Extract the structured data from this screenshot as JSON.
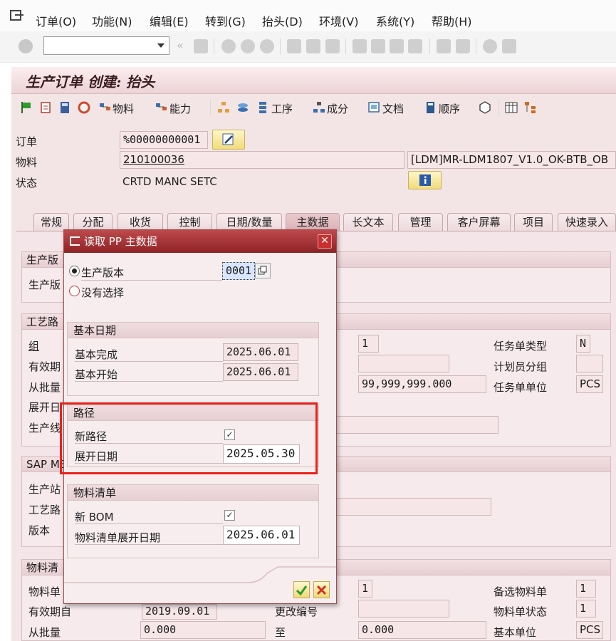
{
  "menu": [
    "订单(O)",
    "功能(N)",
    "编辑(E)",
    "转到(G)",
    "抬头(D)",
    "环境(V)",
    "系统(Y)",
    "帮助(H)"
  ],
  "page_title": "生产订单 创建: 抬头",
  "app_toolbar": {
    "material_label": "物料",
    "capacity_label": "能力",
    "operation_label": "工序",
    "component_label": "成分",
    "document_label": "文档",
    "sequence_label": "顺序"
  },
  "header": {
    "order_label": "订单",
    "order_value": "%00000000001",
    "material_label": "物料",
    "material_value": "210100036",
    "material_desc": "[LDM]MR-LDM1807_V1.0_OK-BTB_OB",
    "status_label": "状态",
    "status_value": "CRTD MANC SETC"
  },
  "tabs": [
    "常规",
    "分配",
    "收货",
    "控制",
    "日期/数量",
    "主数据",
    "长文本",
    "管理",
    "客户屏幕",
    "项目",
    "快速录入"
  ],
  "active_tab": "主数据",
  "background": {
    "group1_title": "生产版",
    "group1_row_label": "生产版",
    "group2_title": "工艺路",
    "group2_rows": [
      "组",
      "有效期",
      "从批量",
      "展开日",
      "生产线"
    ],
    "group2_right": {
      "counter_value": "1",
      "to_lot_value": "99,999,999.000",
      "task_type_label": "任务单类型",
      "task_type_value": "N",
      "planner_group_label": "计划员分组",
      "planner_group_value": "",
      "task_unit_label": "任务单单位",
      "task_unit_value": "PCS"
    },
    "group3_title": "SAP ME",
    "group3_rows": [
      "生产站",
      "工艺路",
      "版本"
    ],
    "group4_title": "物料清",
    "group4_rows": [
      "物料单",
      "有效期自",
      "从批量"
    ],
    "group4_right": {
      "bom_counter_value": "1",
      "alt_bom_label": "备选物料单",
      "alt_bom_value": "1",
      "valid_from_value": "2019.09.01",
      "change_no_label": "更改编号",
      "change_no_value": "",
      "bom_status_label": "物料单状态",
      "bom_status_value": "1",
      "from_lot_value": "0.000",
      "to_label": "至",
      "to_value": "0.000",
      "base_unit_label": "基本单位",
      "base_unit_value": "PCS"
    }
  },
  "dialog": {
    "title": "读取 PP 主数据",
    "radio_version_label": "生产版本",
    "radio_version_value": "0001",
    "radio_none_label": "没有选择",
    "basic_dates": {
      "title": "基本日期",
      "finish_label": "基本完成",
      "finish_value": "2025.06.01",
      "start_label": "基本开始",
      "start_value": "2025.06.01"
    },
    "routing": {
      "title": "路径",
      "new_routing_label": "新路径",
      "new_routing_checked": true,
      "explosion_date_label": "展开日期",
      "explosion_date_value": "2025.05.30"
    },
    "bom": {
      "title": "物料清单",
      "new_bom_label": "新 BOM",
      "new_bom_checked": true,
      "explosion_date_label": "物料清单展开日期",
      "explosion_date_value": "2025.06.01"
    },
    "confirm_icon": "check-icon",
    "cancel_icon": "cancel-icon"
  },
  "colors": {
    "dialog_title": "#9e2a2d",
    "highlight_box": "#e8221b",
    "background": "#f3e5e6"
  }
}
